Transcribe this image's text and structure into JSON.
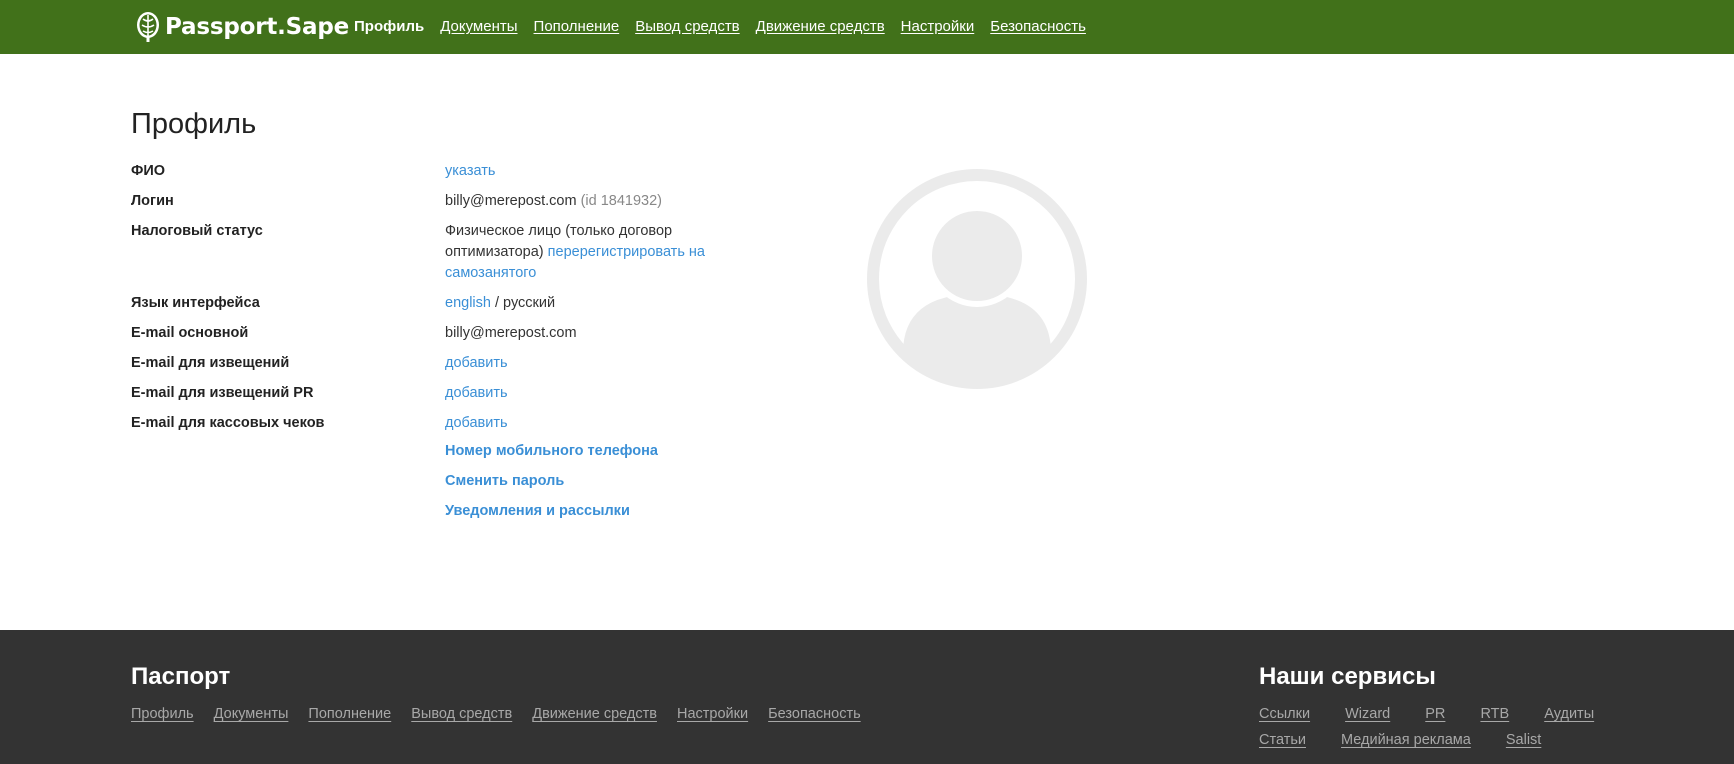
{
  "header": {
    "logo_text": "Passport.Sape",
    "nav": [
      {
        "label": "Профиль",
        "active": true
      },
      {
        "label": "Документы"
      },
      {
        "label": "Пополнение"
      },
      {
        "label": "Вывод средств"
      },
      {
        "label": "Движение средств"
      },
      {
        "label": "Настройки"
      },
      {
        "label": "Безопасность"
      }
    ],
    "colors": {
      "bar": "#41711a"
    }
  },
  "main": {
    "title": "Профиль",
    "fio": {
      "label": "ФИО",
      "action": "указать"
    },
    "login": {
      "label": "Логин",
      "value": "billy@merepost.com",
      "id": "(id 1841932)"
    },
    "tax": {
      "label": "Налоговый статус",
      "value": "Физическое лицо (только договор оптимизатора)",
      "action": "перерегистрировать на самозанятого"
    },
    "language": {
      "label": "Язык интерфейса",
      "option_en": "english",
      "separator": " / ",
      "current": "русский"
    },
    "email_main": {
      "label": "E-mail основной",
      "value": "billy@merepost.com"
    },
    "email_notify": {
      "label": "E-mail для извещений",
      "action": "добавить"
    },
    "email_notify_pr": {
      "label": "E-mail для извещений PR",
      "action": "добавить"
    },
    "email_receipts": {
      "label": "E-mail для кассовых чеков",
      "action": "добавить"
    },
    "links": {
      "phone": "Номер мобильного телефона",
      "password": "Сменить пароль",
      "notifications": "Уведомления и рассылки"
    },
    "avatar_icon": "user-avatar-icon",
    "colors": {
      "link": "#3a8fd6"
    }
  },
  "footer": {
    "passport": {
      "title": "Паспорт",
      "links": [
        "Профиль",
        "Документы",
        "Пополнение",
        "Вывод средств",
        "Движение средств",
        "Настройки",
        "Безопасность"
      ]
    },
    "services": {
      "title": "Наши сервисы",
      "row1": [
        "Ссылки",
        "Wizard",
        "PR",
        "RTB",
        "Аудиты"
      ],
      "row2": [
        "Статьи",
        "Медийная реклама",
        "Salist"
      ]
    },
    "colors": {
      "background": "#333333"
    }
  }
}
